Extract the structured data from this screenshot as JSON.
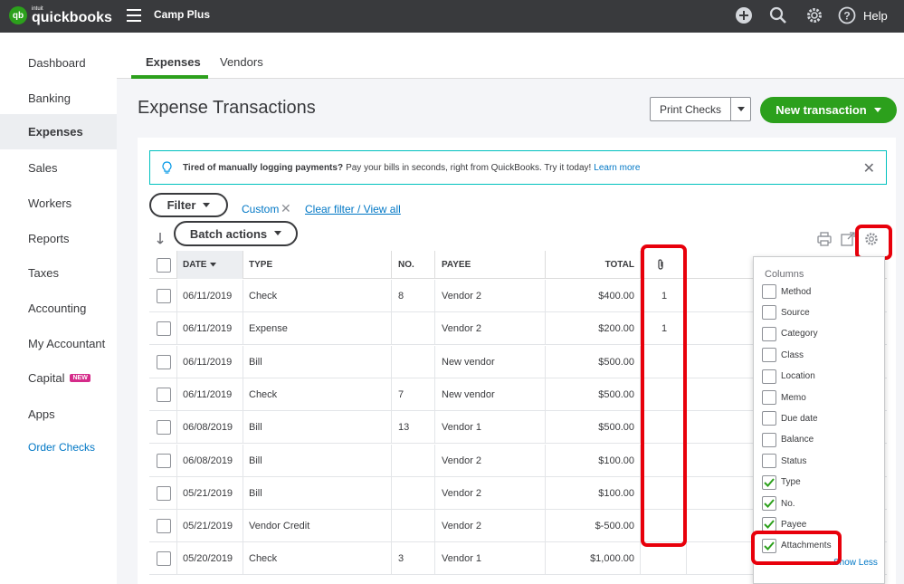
{
  "app": {
    "logo_mark": "qb",
    "logo_intuit": "intuit",
    "logo_name": "quickbooks",
    "company": "Camp Plus",
    "help": "Help"
  },
  "sidebar": {
    "items": [
      {
        "label": "Dashboard"
      },
      {
        "label": "Banking"
      },
      {
        "label": "Expenses"
      },
      {
        "label": "Sales"
      },
      {
        "label": "Workers"
      },
      {
        "label": "Reports"
      },
      {
        "label": "Taxes"
      },
      {
        "label": "Accounting"
      },
      {
        "label": "My Accountant"
      },
      {
        "label": "Capital",
        "badge": "NEW"
      },
      {
        "label": "Apps"
      },
      {
        "label": "Order Checks"
      }
    ]
  },
  "tabs": [
    {
      "label": "Expenses"
    },
    {
      "label": "Vendors"
    }
  ],
  "page": {
    "title": "Expense Transactions",
    "print_checks": "Print Checks",
    "new_transaction": "New transaction"
  },
  "banner": {
    "bold": "Tired of manually logging payments?",
    "text": "Pay your bills in seconds, right from QuickBooks. Try it today!",
    "link": "Learn more"
  },
  "filters": {
    "filter": "Filter",
    "custom": "Custom",
    "clear": "Clear filter / View all",
    "batch": "Batch actions"
  },
  "table": {
    "headers": {
      "date": "DATE",
      "type": "TYPE",
      "no": "NO.",
      "payee": "PAYEE",
      "total": "TOTAL"
    },
    "rows": [
      {
        "date": "06/11/2019",
        "type": "Check",
        "no": "8",
        "payee": "Vendor 2",
        "total": "$400.00",
        "attach": "1"
      },
      {
        "date": "06/11/2019",
        "type": "Expense",
        "no": "",
        "payee": "Vendor 2",
        "total": "$200.00",
        "attach": "1"
      },
      {
        "date": "06/11/2019",
        "type": "Bill",
        "no": "",
        "payee": "New vendor",
        "total": "$500.00",
        "attach": ""
      },
      {
        "date": "06/11/2019",
        "type": "Check",
        "no": "7",
        "payee": "New vendor",
        "total": "$500.00",
        "attach": ""
      },
      {
        "date": "06/08/2019",
        "type": "Bill",
        "no": "13",
        "payee": "Vendor 1",
        "total": "$500.00",
        "attach": ""
      },
      {
        "date": "06/08/2019",
        "type": "Bill",
        "no": "",
        "payee": "Vendor 2",
        "total": "$100.00",
        "attach": ""
      },
      {
        "date": "05/21/2019",
        "type": "Bill",
        "no": "",
        "payee": "Vendor 2",
        "total": "$100.00",
        "attach": ""
      },
      {
        "date": "05/21/2019",
        "type": "Vendor Credit",
        "no": "",
        "payee": "Vendor 2",
        "total": "$-500.00",
        "attach": ""
      },
      {
        "date": "05/20/2019",
        "type": "Check",
        "no": "3",
        "payee": "Vendor 1",
        "total": "$1,000.00",
        "attach": ""
      }
    ]
  },
  "columns_popup": {
    "title": "Columns",
    "options": [
      {
        "label": "Method",
        "checked": false
      },
      {
        "label": "Source",
        "checked": false
      },
      {
        "label": "Category",
        "checked": false
      },
      {
        "label": "Class",
        "checked": false
      },
      {
        "label": "Location",
        "checked": false
      },
      {
        "label": "Memo",
        "checked": false
      },
      {
        "label": "Due date",
        "checked": false
      },
      {
        "label": "Balance",
        "checked": false
      },
      {
        "label": "Status",
        "checked": false
      },
      {
        "label": "Type",
        "checked": true
      },
      {
        "label": "No.",
        "checked": true
      },
      {
        "label": "Payee",
        "checked": true
      },
      {
        "label": "Attachments",
        "checked": true
      }
    ],
    "show_less": "Show Less"
  },
  "colors": {
    "brand_green": "#2ca01c",
    "topbar": "#393a3d",
    "link": "#0077c5",
    "highlight": "#e8000b"
  }
}
